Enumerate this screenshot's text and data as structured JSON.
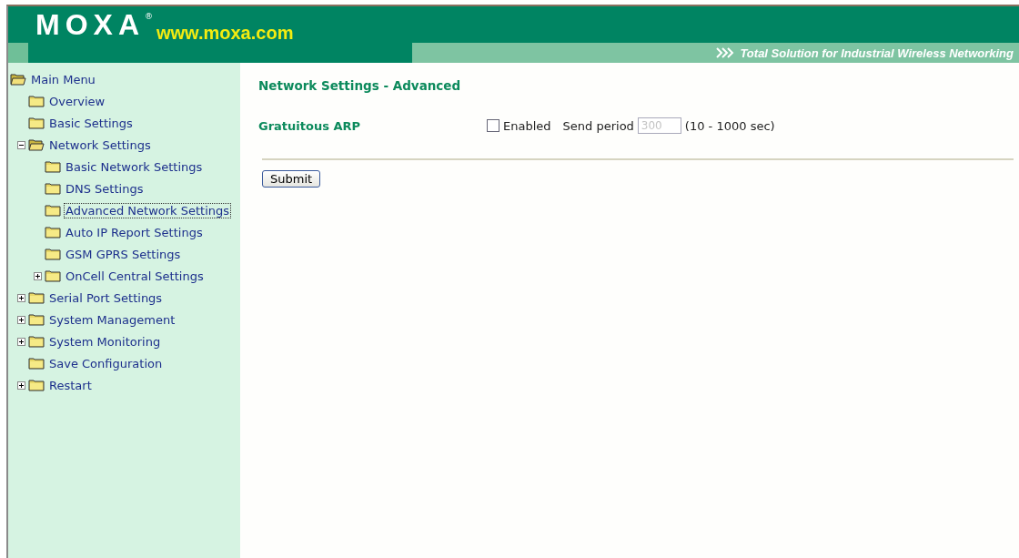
{
  "header": {
    "logo": "MOXA",
    "registered": "®",
    "website": "www.moxa.com",
    "tagline": "Total Solution for Industrial Wireless Networking"
  },
  "sidebar": {
    "tree": [
      {
        "label": "Main Menu",
        "selected": false,
        "children": [
          {
            "label": "Overview",
            "selected": false
          },
          {
            "label": "Basic Settings",
            "selected": false
          },
          {
            "label": "Network Settings",
            "selected": false,
            "expanded": true,
            "children": [
              {
                "label": "Basic Network Settings",
                "selected": false
              },
              {
                "label": "DNS Settings",
                "selected": false
              },
              {
                "label": "Advanced Network Settings",
                "selected": true
              },
              {
                "label": "Auto IP Report Settings",
                "selected": false
              },
              {
                "label": "GSM GPRS Settings",
                "selected": false
              },
              {
                "label": "OnCell Central Settings",
                "selected": false,
                "expanded": false
              }
            ]
          },
          {
            "label": "Serial Port Settings",
            "selected": false,
            "expanded": false
          },
          {
            "label": "System Management",
            "selected": false,
            "expanded": false
          },
          {
            "label": "System Monitoring",
            "selected": false,
            "expanded": false
          },
          {
            "label": "Save Configuration",
            "selected": false
          },
          {
            "label": "Restart",
            "selected": false,
            "expanded": false
          }
        ]
      }
    ]
  },
  "content": {
    "title": "Network Settings - Advanced",
    "rows": [
      {
        "label": "Gratuitous ARP",
        "checkbox": {
          "label": "Enabled",
          "checked": false
        },
        "period_label": "Send period",
        "period_value": "300",
        "period_disabled": true,
        "hint": "(10 - 1000 sec)"
      }
    ],
    "submit": "Submit"
  }
}
